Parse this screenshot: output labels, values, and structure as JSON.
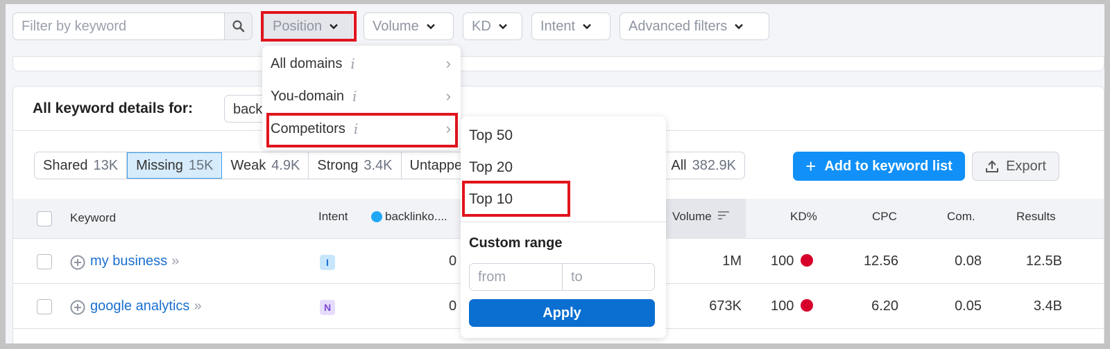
{
  "filters": {
    "search_placeholder": "Filter by keyword",
    "position_label": "Position",
    "volume_label": "Volume",
    "kd_label": "KD",
    "intent_label": "Intent",
    "advanced_label": "Advanced filters"
  },
  "position_menu": {
    "items": [
      {
        "label": "All domains"
      },
      {
        "label": "You-domain"
      },
      {
        "label": "Competitors"
      }
    ],
    "info_glyph": "i",
    "arrow_glyph": "›"
  },
  "competitors_submenu": {
    "items": [
      {
        "label": "Top 50"
      },
      {
        "label": "Top 20"
      },
      {
        "label": "Top 10"
      }
    ],
    "custom_range_title": "Custom range",
    "from_placeholder": "from",
    "to_placeholder": "to",
    "apply_label": "Apply"
  },
  "card": {
    "title": "All keyword details for:",
    "domain_value": "backlinko.com",
    "segments": [
      {
        "label": "Shared",
        "count": "13K"
      },
      {
        "label": "Missing",
        "count": "15K"
      },
      {
        "label": "Weak",
        "count": "4.9K"
      },
      {
        "label": "Strong",
        "count": "3.4K"
      },
      {
        "label": "Untapped",
        "count": ""
      }
    ],
    "all_segment": {
      "label": "All",
      "count": "382.9K"
    },
    "add_button": "Add to keyword list",
    "add_icon": "+",
    "export_button": "Export"
  },
  "table": {
    "headers": {
      "keyword": "Keyword",
      "intent": "Intent",
      "domain": "backlinko....",
      "volume": "Volume",
      "kd": "KD%",
      "cpc": "CPC",
      "com": "Com.",
      "results": "Results"
    },
    "rows": [
      {
        "keyword": "my business",
        "intent": "I",
        "position": "0",
        "volume": "1M",
        "kd": "100",
        "cpc": "12.56",
        "com": "0.08",
        "results": "12.5B"
      },
      {
        "keyword": "google analytics",
        "intent": "N",
        "position": "0",
        "volume": "673K",
        "kd": "100",
        "cpc": "6.20",
        "com": "0.05",
        "results": "3.4B"
      }
    ]
  },
  "colors": {
    "accent": "#1090f8",
    "apply": "#0a6fd1",
    "highlight": "#e1141d",
    "kd_hard": "#d6002b",
    "intent_informational_bg": "#c8e6fb",
    "intent_navigational_bg": "#e6dcfb"
  }
}
